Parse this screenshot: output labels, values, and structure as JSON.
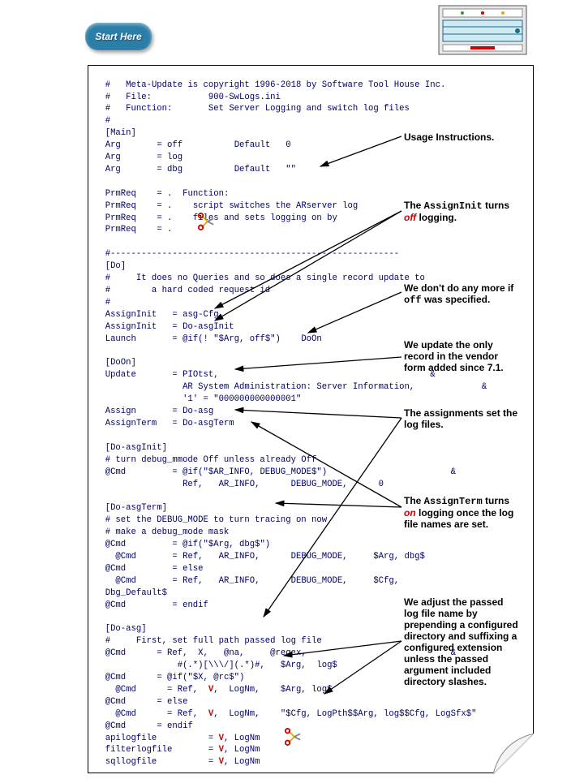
{
  "badge": {
    "label": "Start Here"
  },
  "copyright": "Meta-Update is copyright 1996-2018 by Software Tool House Inc.",
  "file_label": "File:",
  "file_value": "900-SwLogs.ini",
  "function_label": "Function:",
  "function_value": "Set Server Logging and switch log files",
  "main_hdr": "[Main]",
  "arg1": {
    "k": "Arg",
    "v": "= off",
    "c": "Default",
    "d": "0"
  },
  "arg2": {
    "k": "Arg",
    "v": "= log"
  },
  "arg3": {
    "k": "Arg",
    "v": "= dbg",
    "c": "Default",
    "d": "\"\""
  },
  "prm1": {
    "k": "PrmReq",
    "v": "= .  Function:"
  },
  "prm2": {
    "k": "PrmReq",
    "v": "= .    script switches the ARserver log"
  },
  "prm3": {
    "k": "PrmReq",
    "v": "= .    files and sets logging on by"
  },
  "prm4": {
    "k": "PrmReq",
    "v": "= ."
  },
  "sep": "#--------------------------------------------------------",
  "do_hdr": "[Do]",
  "do_c1": "#     It does no Queries and so does a single record update to",
  "do_c2": "#        a hard coded request id",
  "ai1": {
    "k": "AssignInit",
    "v": "= asg-Cfg"
  },
  "ai2": {
    "k": "AssignInit",
    "v": "= Do-asgInit"
  },
  "launch": {
    "k": "Launch",
    "v": "= @if(! \"$Arg, off$\")    DoOn"
  },
  "doon_hdr": "[DoOn]",
  "update1": {
    "k": "Update",
    "v": "= PIOtst,",
    "tail": "&"
  },
  "update2": "AR System Administration: Server Information,",
  "update3": "'1' = \"000000000000001\"",
  "assign": {
    "k": "Assign",
    "v": "= Do-asg"
  },
  "assignTerm": {
    "k": "AssignTerm",
    "v": "= Do-asgTerm"
  },
  "asgInit_hdr": "[Do-asgInit]",
  "asgInit_c": "# turn debug_mmode Off unless already Off",
  "asgInit_cmd1": {
    "k": "@Cmd",
    "v": "= @if(\"$AR_INFO, DEBUG_MODE$\")",
    "tail": "&"
  },
  "asgInit_cmd2": "Ref,   AR_INFO,      DEBUG_MODE,      0",
  "asgTerm_hdr": "[Do-asgTerm]",
  "asgTerm_c1": "# set the DEBUG_MODE to turn tracing on now",
  "asgTerm_c2": "# make a debug_mode mask",
  "asgTerm_cmd1": {
    "k": "@Cmd",
    "v": "= @if(\"$Arg, dbg$\")"
  },
  "asgTerm_cmd2": {
    "k": "  @Cmd",
    "v": "= Ref,   AR_INFO,      DEBUG_MODE,     $Arg, dbg$"
  },
  "asgTerm_cmd3": {
    "k": "@Cmd",
    "v": "= else"
  },
  "asgTerm_cmd4": {
    "k": "  @Cmd",
    "v": "= Ref,   AR_INFO,      DEBUG_MODE,     $Cfg,"
  },
  "asgTerm_cmd4b": "Dbg_Default$",
  "asgTerm_cmd5": {
    "k": "@Cmd",
    "v": "= endif"
  },
  "asg_hdr": "[Do-asg]",
  "asg_c": "#     First, set full path passed log file",
  "asg_cmd1": {
    "k": "@Cmd",
    "v": "= Ref,  X,   @na,     @regex,",
    "tail": "&"
  },
  "asg_cmd1b": "#(.*)[\\\\\\/](.*)#,   $Arg,  log$",
  "asg_cmd2": {
    "k": "@Cmd",
    "v": "= @if(\"$X, @rc$\")"
  },
  "asg_cmd3a": "  @Cmd      = Ref,  ",
  "asg_cmd3b": ",  LogNm,    $Arg, log$",
  "asg_cmd4": {
    "k": "@Cmd",
    "v": "= else"
  },
  "asg_cmd5a": "  @Cmd      = Ref,  ",
  "asg_cmd5b": ",  LogNm,    \"$Cfg, LogPth$$Arg, log$$Cfg, LogSfx$\"",
  "asg_cmd6": {
    "k": "@Cmd",
    "v": "= endif"
  },
  "lf1a": "apilogfile          = ",
  "lf1b": ", LogNm",
  "lf2a": "filterlogfile       = ",
  "lf2b": ", LogNm",
  "lf3a": "sqllogfile          = ",
  "lf3b": ", LogNm",
  "V": "V",
  "ann": {
    "usage": "Usage Instructions.",
    "a_init_1": "The ",
    "a_init_mono": "AssignInit",
    "a_init_2": " turns ",
    "a_init_off": "off",
    "a_init_3": " logging.",
    "anymore_1": "We don't do any more if ",
    "anymore_mono": "off",
    "anymore_2": " was specified.",
    "vendor_1": "We update the only",
    "vendor_2": "record in the vendor",
    "vendor_3": "form added since 7.1.",
    "assigns_1": "The assignments set the",
    "assigns_2": "log files.",
    "a_term_1": "The ",
    "a_term_mono": "AssignTerm",
    "a_term_2": " turns ",
    "a_term_on": "on",
    "a_term_3": " logging once the log",
    "a_term_4": "file names are set.",
    "adjust_1": "We adjust the passed",
    "adjust_2": "log file name by",
    "adjust_3": "prepending a configured",
    "adjust_4": "directory and suffixing a",
    "adjust_5": "configured extension",
    "adjust_6": "unless the passed",
    "adjust_7": "argument included",
    "adjust_8": "directory slashes."
  }
}
